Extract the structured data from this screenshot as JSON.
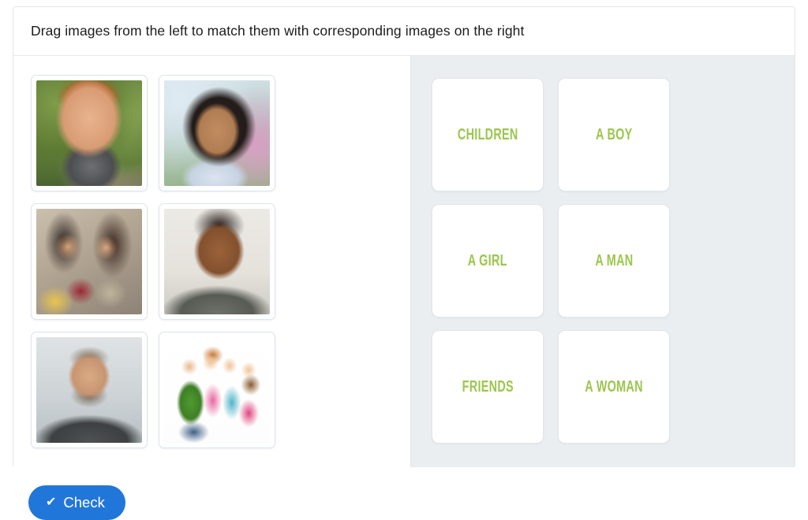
{
  "exercise": {
    "title": "Drag images from the left to match them with corresponding images on the right",
    "source_pane_name": "draggable images",
    "target_pane_name": "drop targets",
    "accent_green": "#9cc64d",
    "button_blue": "#2176d9",
    "right_pane_bg": "#eaeef1"
  },
  "drag_items": [
    {
      "id": "item-1",
      "alt": "boy-with-red-hair-photo",
      "photo_class": "photo-boy"
    },
    {
      "id": "item-2",
      "alt": "girl-with-dark-curly-hair-photo",
      "photo_class": "photo-girl"
    },
    {
      "id": "item-3",
      "alt": "two-young-women-with-phones-photo",
      "photo_class": "photo-friends"
    },
    {
      "id": "item-4",
      "alt": "smiling-woman-photo",
      "photo_class": "photo-woman"
    },
    {
      "id": "item-5",
      "alt": "bearded-man-at-beach-photo",
      "photo_class": "photo-man"
    },
    {
      "id": "item-6",
      "alt": "four-laughing-children-photo",
      "photo_class": "photo-children"
    }
  ],
  "targets": [
    {
      "id": "target-children",
      "label": "CHILDREN"
    },
    {
      "id": "target-a-boy",
      "label": "A BOY"
    },
    {
      "id": "target-a-girl",
      "label": "A GIRL"
    },
    {
      "id": "target-a-man",
      "label": "A MAN"
    },
    {
      "id": "target-friends",
      "label": "FRIENDS"
    },
    {
      "id": "target-a-woman",
      "label": "A WOMAN"
    }
  ],
  "footer": {
    "check_label": "Check",
    "check_icon": "check-mark-icon",
    "check_glyph": "✔"
  }
}
